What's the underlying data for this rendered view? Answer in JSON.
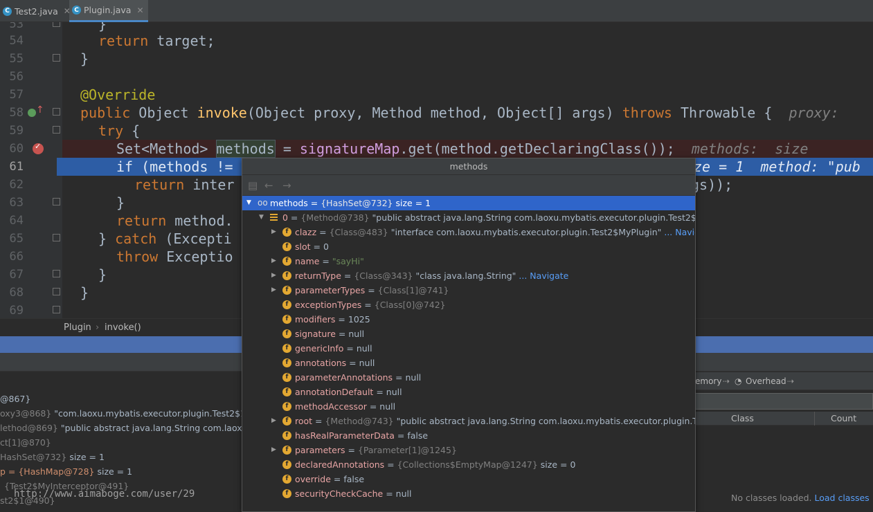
{
  "tabs": [
    {
      "label": "Test2.java",
      "icon": "java-class-icon",
      "active": false
    },
    {
      "label": "Plugin.java",
      "icon": "java-class-icon",
      "active": true
    }
  ],
  "editor": {
    "line_numbers": [
      "53",
      "54",
      "55",
      "56",
      "57",
      "58",
      "59",
      "60",
      "61",
      "62",
      "63",
      "64",
      "65",
      "66",
      "67",
      "68",
      "69"
    ],
    "lines": {
      "l53": "}",
      "l54_kw": "return",
      "l54_rest": " target;",
      "l55": "}",
      "l57": "@Override",
      "l58_kw1": "public",
      "l58_t1": " Object ",
      "l58_fn": "invoke",
      "l58_t2": "(Object proxy, Method method, Object[] args) ",
      "l58_kw2": "throws",
      "l58_t3": " Throwable {  ",
      "l58_hint": "proxy:",
      "l59_kw": "try",
      "l59_rest": " {",
      "l60_a": "Set<Method> ",
      "l60_sel": "methods",
      "l60_b": " = ",
      "l60_fn": "signatureMap",
      "l60_c": ".get(method.getDeclaringClass());  ",
      "l60_hint": "methods:  size",
      "l61_kw": "if",
      "l61_a": " (methods !=",
      "l61_hint": "ze = 1  method: \"pub",
      "l62_kw": "return",
      "l62_a": " inter",
      "l62_b": "gs));",
      "l63": "}",
      "l64_kw": "return",
      "l64_a": " method.",
      "l65_a": "} ",
      "l65_kw": "catch",
      "l65_b": " (Excepti",
      "l66_kw": "throw",
      "l66_a": " Exceptio",
      "l67": "}",
      "l68": "}"
    }
  },
  "breadcrumb": [
    "Plugin",
    "invoke()"
  ],
  "popup": {
    "title": "methods",
    "rows": [
      {
        "expand": "down",
        "icon": "watch",
        "name": "methods",
        "eq": " = ",
        "ref": "{HashSet@732}",
        "val": "  size = 1"
      },
      {
        "expand": "down",
        "icon": "list",
        "name": "0",
        "eq": " = ",
        "ref": "{Method@738}",
        "val": " \"public abstract java.lang.String com.laoxu.mybatis.executor.plugin.Test2$MyPlugin"
      },
      {
        "expand": "right",
        "icon": "f",
        "name": "clazz",
        "eq": " = ",
        "ref": "{Class@483}",
        "val": " \"interface com.laoxu.mybatis.executor.plugin.Test2$MyPlugin\"",
        "nav": " ... Navigate"
      },
      {
        "expand": "",
        "icon": "f",
        "name": "slot",
        "eq": " = ",
        "ref": "",
        "val": "0"
      },
      {
        "expand": "right",
        "icon": "f",
        "name": "name",
        "eq": " = ",
        "ref": "",
        "val": "",
        "str": "\"sayHi\""
      },
      {
        "expand": "right",
        "icon": "f",
        "name": "returnType",
        "eq": " = ",
        "ref": "{Class@343}",
        "val": " \"class java.lang.String\"",
        "nav": " ... Navigate"
      },
      {
        "expand": "right",
        "icon": "f",
        "name": "parameterTypes",
        "eq": " = ",
        "ref": "{Class[1]@741}",
        "val": ""
      },
      {
        "expand": "",
        "icon": "f",
        "name": "exceptionTypes",
        "eq": " = ",
        "ref": "{Class[0]@742}",
        "val": ""
      },
      {
        "expand": "",
        "icon": "f",
        "name": "modifiers",
        "eq": " = ",
        "ref": "",
        "val": "1025"
      },
      {
        "expand": "",
        "icon": "f",
        "name": "signature",
        "eq": " = ",
        "ref": "",
        "val": "null"
      },
      {
        "expand": "",
        "icon": "f",
        "name": "genericInfo",
        "eq": " = ",
        "ref": "",
        "val": "null"
      },
      {
        "expand": "",
        "icon": "f",
        "name": "annotations",
        "eq": " = ",
        "ref": "",
        "val": "null"
      },
      {
        "expand": "",
        "icon": "f",
        "name": "parameterAnnotations",
        "eq": " = ",
        "ref": "",
        "val": "null"
      },
      {
        "expand": "",
        "icon": "f",
        "name": "annotationDefault",
        "eq": " = ",
        "ref": "",
        "val": "null"
      },
      {
        "expand": "",
        "icon": "f",
        "name": "methodAccessor",
        "eq": " = ",
        "ref": "",
        "val": "null"
      },
      {
        "expand": "right",
        "icon": "f",
        "name": "root",
        "eq": " = ",
        "ref": "{Method@743}",
        "val": " \"public abstract java.lang.String com.laoxu.mybatis.executor.plugin.Test2$My"
      },
      {
        "expand": "",
        "icon": "f",
        "name": "hasRealParameterData",
        "eq": " = ",
        "ref": "",
        "val": "false"
      },
      {
        "expand": "right",
        "icon": "f",
        "name": "parameters",
        "eq": " = ",
        "ref": "{Parameter[1]@1245}",
        "val": ""
      },
      {
        "expand": "",
        "icon": "f",
        "name": "declaredAnnotations",
        "eq": " = ",
        "ref": "{Collections$EmptyMap@1247}",
        "val": "  size = 0"
      },
      {
        "expand": "",
        "icon": "f",
        "name": "override",
        "eq": " = ",
        "ref": "",
        "val": "false"
      },
      {
        "expand": "",
        "icon": "f",
        "name": "securityCheckCache",
        "eq": " = ",
        "ref": "",
        "val": "null"
      }
    ]
  },
  "variables": [
    {
      "pre": "",
      "text": "@867}"
    },
    {
      "pre": "oxy3@868}",
      "text": " \"com.laoxu.mybatis.executor.plugin.Test2$1@2d6"
    },
    {
      "pre": "lethod@869}",
      "text": " \"public abstract java.lang.String com.laoxu.myb"
    },
    {
      "pre": "ct[1]@870}",
      "text": ""
    },
    {
      "pre": "HashSet@732}",
      "text": "  size = 1"
    },
    {
      "pre": "p = {HashMap@728}",
      "text": "  size = 1"
    },
    {
      "pre": "{Test2$MyInterceptor@491}",
      "text": ""
    },
    {
      "pre": "st2$1@490}",
      "text": ""
    }
  ],
  "memory": {
    "tab_memory": "emory",
    "tab_overhead": "Overhead",
    "col_class": "Class",
    "col_count": "Count",
    "empty_text": "No classes loaded.",
    "load_link": "Load classes"
  },
  "watermark": "http://www.aimaboge.com/user/29"
}
